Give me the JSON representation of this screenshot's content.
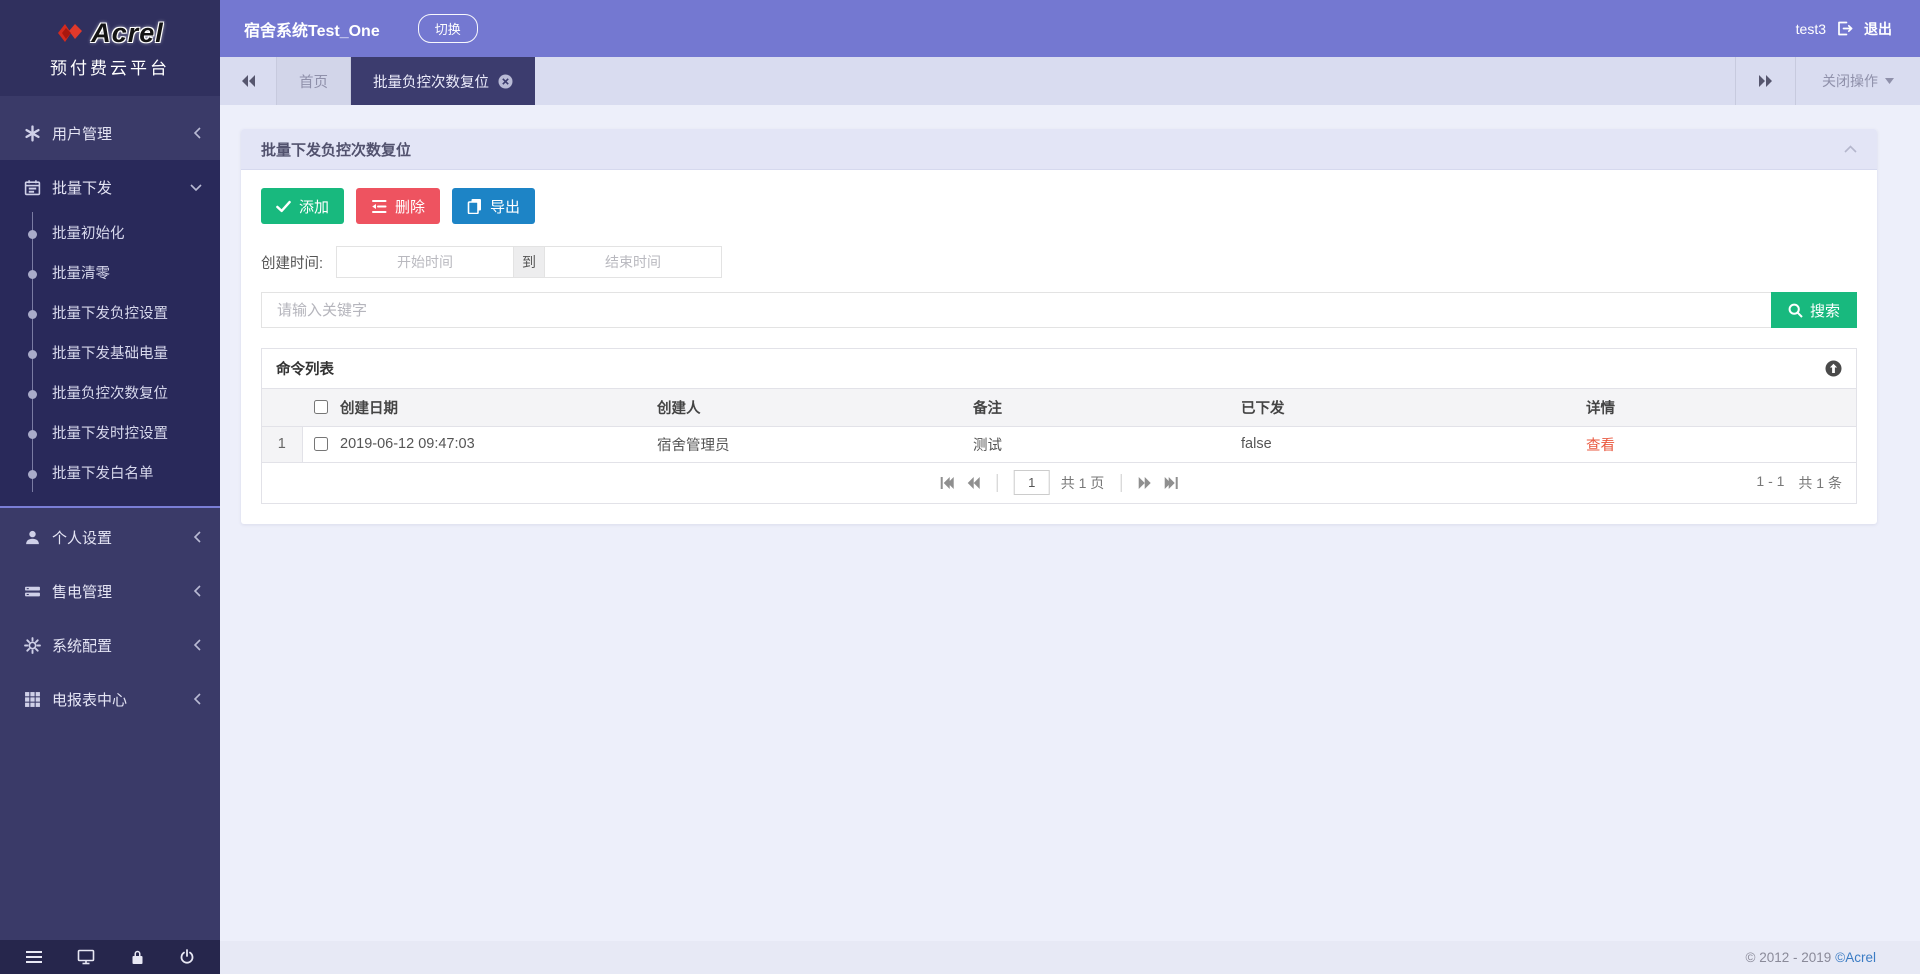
{
  "brand": {
    "logo": "Acrel",
    "subtitle": "预付费云平台"
  },
  "topbar": {
    "system_name": "宿舍系统Test_One",
    "switch_button": "切换",
    "username": "test3",
    "logout": "退出"
  },
  "tabs": {
    "home": "首页",
    "active": "批量负控次数复位",
    "close_menu": "关闭操作"
  },
  "sidebar": {
    "items": [
      {
        "label": "用户管理"
      },
      {
        "label": "批量下发",
        "children": [
          "批量初始化",
          "批量清零",
          "批量下发负控设置",
          "批量下发基础电量",
          "批量负控次数复位",
          "批量下发时控设置",
          "批量下发白名单"
        ]
      },
      {
        "label": "个人设置"
      },
      {
        "label": "售电管理"
      },
      {
        "label": "系统配置"
      },
      {
        "label": "电报表中心"
      }
    ]
  },
  "panel": {
    "title": "批量下发负控次数复位",
    "toolbar": {
      "add": "添加",
      "delete": "删除",
      "export": "导出"
    },
    "filters": {
      "create_time_label": "创建时间:",
      "start_placeholder": "开始时间",
      "to": "到",
      "end_placeholder": "结束时间",
      "keyword_placeholder": "请输入关键字",
      "search": "搜索"
    },
    "list": {
      "title": "命令列表",
      "columns": [
        "创建日期",
        "创建人",
        "备注",
        "已下发",
        "详情"
      ],
      "rows": [
        {
          "index": "1",
          "date": "2019-06-12 09:47:03",
          "creator": "宿舍管理员",
          "remark": "测试",
          "issued": "false",
          "detail": "查看"
        }
      ],
      "pagination": {
        "page": "1",
        "total_pages": "共 1 页",
        "range": "1 - 1",
        "total": "共 1 条"
      }
    }
  },
  "footer": {
    "copyright": "© 2012 - 2019",
    "brand_link": "©Acrel"
  },
  "colors": {
    "topbar": "#7478d1",
    "sidebar": "#3a3a68",
    "green": "#18b97e",
    "red": "#ee5360",
    "blue": "#1d84c6",
    "detail_link": "#e9583f"
  }
}
